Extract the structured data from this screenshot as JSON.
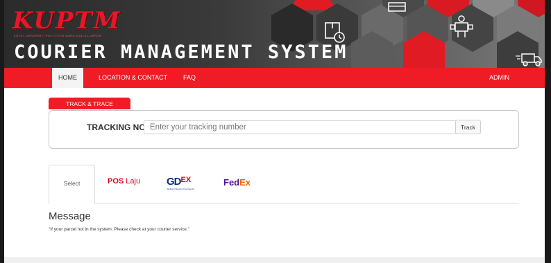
{
  "banner": {
    "logo": "KUPTM",
    "logo_subtitle": "KOLEJ UNIVERSITI POLY-TECH MARA KUALA LUMPUR",
    "system_title": "COURIER MANAGEMENT SYSTEM",
    "icons": [
      "package-clock-icon",
      "delivery-person-icon",
      "delivery-truck-icon",
      "box-icon"
    ]
  },
  "nav": {
    "items": [
      {
        "label": "HOME",
        "active": true
      },
      {
        "label": "LOCATION & CONTACT",
        "active": false
      },
      {
        "label": "FAQ",
        "active": false
      }
    ],
    "admin_label": "ADMIN"
  },
  "track": {
    "tab_label": "TRACK & TRACE",
    "label": "TRACKING NO:",
    "placeholder": "Enter your tracking number",
    "value": "",
    "button_label": "Track"
  },
  "couriers": {
    "select_label": "Select",
    "poslaju": {
      "pos": "POS",
      "laju": "Laju"
    },
    "gdex": {
      "gd": "GD",
      "ex": "EX",
      "tagline": "Delivery Beyond Your Needs"
    },
    "fedex": {
      "fed": "Fed",
      "ex": "Ex"
    }
  },
  "message": {
    "title": "Message",
    "text": "\"If your parcel not in the system. Please check at your courier service.\""
  },
  "colors": {
    "primary_red": "#ef1c25",
    "banner_dark": "#2b2b2b"
  }
}
